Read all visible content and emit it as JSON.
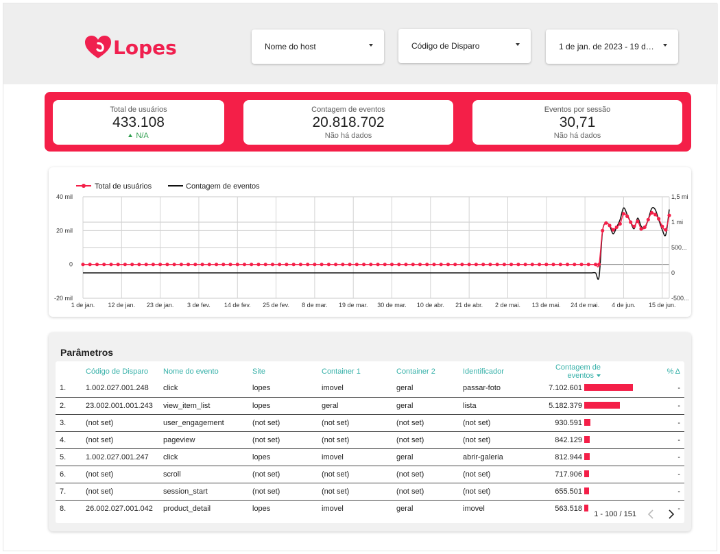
{
  "brand": {
    "name": "Lopes",
    "color": "#f0204f"
  },
  "filters": {
    "host": "Nome do host",
    "trigger_code": "Código de Disparo",
    "date_range": "1 de jan. de 2023 - 19 de ..."
  },
  "kpis": [
    {
      "label": "Total de usuários",
      "value": "433.108",
      "sub": "N/A"
    },
    {
      "label": "Contagem de eventos",
      "value": "20.818.702",
      "sub": "Não há dados"
    },
    {
      "label": "Eventos por sessão",
      "value": "30,71",
      "sub": "Não há dados"
    }
  ],
  "chart_data": {
    "type": "line",
    "legend_placement": "top-left",
    "grid": true,
    "x_tick_labels": [
      "1 de jan.",
      "12 de jan.",
      "23 de jan.",
      "3 de fev.",
      "14 de fev.",
      "25 de fev.",
      "8 de mar.",
      "19 de mar.",
      "30 de mar.",
      "10 de abr.",
      "21 de abr.",
      "2 de mai.",
      "13 de mai.",
      "24 de mai.",
      "4 de jun.",
      "15 de jun."
    ],
    "y_left": {
      "label": "",
      "ticks": [
        "40 mil",
        "20 mil",
        "0",
        "-20 mil"
      ],
      "ylim": [
        -20000,
        40000
      ]
    },
    "y_right": {
      "label": "",
      "ticks": [
        "1,5 mi",
        "1 mi",
        "500...",
        "0",
        "-500..."
      ],
      "ylim": [
        -500000,
        1500000
      ]
    },
    "series": [
      {
        "name": "Total de usuários",
        "color": "#f41f48",
        "markers": true,
        "axis": "left",
        "flat_days": 147,
        "flat_value": 0,
        "tail": [
          0,
          20000,
          24500,
          23000,
          20500,
          22000,
          24000,
          30000,
          28500,
          25000,
          22500,
          25500,
          21000,
          22000,
          26500,
          30500,
          29500,
          27000,
          22500,
          20500,
          29000
        ]
      },
      {
        "name": "Contagem de eventos",
        "color": "#111111",
        "markers": false,
        "axis": "right",
        "flat_days": 147,
        "flat_value": 0,
        "tail": [
          -80000,
          820000,
          980000,
          930000,
          770000,
          900000,
          1050000,
          1280000,
          1150000,
          1000000,
          870000,
          1080000,
          920000,
          880000,
          1050000,
          1270000,
          1250000,
          1050000,
          850000,
          750000,
          1250000
        ]
      }
    ]
  },
  "table": {
    "title": "Parâmetros",
    "columns": [
      "Código de Disparo",
      "Nome do evento",
      "Site",
      "Container 1",
      "Container 2",
      "Identificador",
      "Contagem de eventos",
      "% Δ"
    ],
    "rows": [
      {
        "idx": "1.",
        "code": "1.002.027.001.248",
        "event": "click",
        "site": "lopes",
        "c1": "imovel",
        "c2": "geral",
        "id": "passar-foto",
        "count": "7.102.601",
        "bar": 1.0,
        "delta": "-"
      },
      {
        "idx": "2.",
        "code": "23.002.001.001.243",
        "event": "view_item_list",
        "site": "lopes",
        "c1": "geral",
        "c2": "geral",
        "id": "lista",
        "count": "5.182.379",
        "bar": 0.7296,
        "delta": "-"
      },
      {
        "idx": "3.",
        "code": "(not set)",
        "event": "user_engagement",
        "site": "(not set)",
        "c1": "(not set)",
        "c2": "(not set)",
        "id": "(not set)",
        "count": "930.591",
        "bar": 0.131,
        "delta": "-"
      },
      {
        "idx": "4.",
        "code": "(not set)",
        "event": "pageview",
        "site": "(not set)",
        "c1": "(not set)",
        "c2": "(not set)",
        "id": "(not set)",
        "count": "842.129",
        "bar": 0.1186,
        "delta": "-"
      },
      {
        "idx": "5.",
        "code": "1.002.027.001.247",
        "event": "click",
        "site": "lopes",
        "c1": "imovel",
        "c2": "geral",
        "id": "abrir-galeria",
        "count": "812.944",
        "bar": 0.1145,
        "delta": "-"
      },
      {
        "idx": "6.",
        "code": "(not set)",
        "event": "scroll",
        "site": "(not set)",
        "c1": "(not set)",
        "c2": "(not set)",
        "id": "(not set)",
        "count": "717.906",
        "bar": 0.1011,
        "delta": "-"
      },
      {
        "idx": "7.",
        "code": "(not set)",
        "event": "session_start",
        "site": "(not set)",
        "c1": "(not set)",
        "c2": "(not set)",
        "id": "(not set)",
        "count": "655.501",
        "bar": 0.0923,
        "delta": "-"
      },
      {
        "idx": "8.",
        "code": "26.002.027.001.042",
        "event": "product_detail",
        "site": "lopes",
        "c1": "imovel",
        "c2": "geral",
        "id": "imovel",
        "count": "563.518",
        "bar": 0.0793,
        "delta": "-"
      }
    ],
    "pagination": "1 - 100 / 151"
  }
}
